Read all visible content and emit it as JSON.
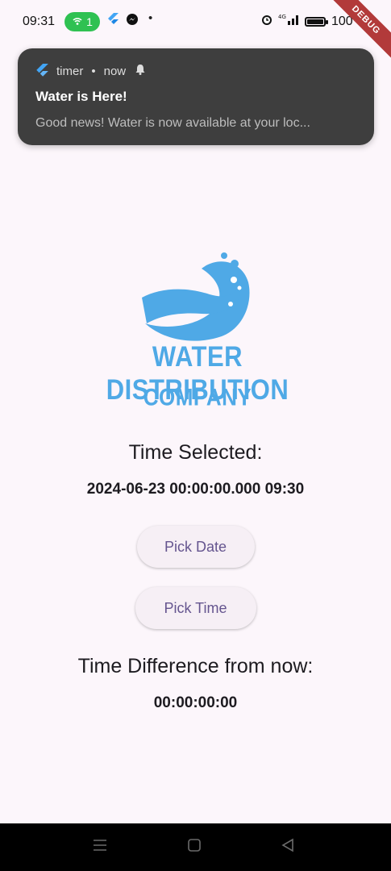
{
  "status_bar": {
    "time": "09:31",
    "hotspot_count": "1",
    "battery_text": "100",
    "battery_level": 1.0,
    "icons": [
      "hotspot-icon",
      "flutter-icon",
      "messenger-icon",
      "dot-icon",
      "alarm-icon",
      "signal-icon",
      "battery-icon"
    ]
  },
  "debug_banner": "DEBUG",
  "notification": {
    "app": "timer",
    "when": "now",
    "title": "Water is Here!",
    "body": "Good news! Water is now available at your loc..."
  },
  "logo": {
    "line1": "WATER DISTRIBUTION",
    "line2": "COMPANY",
    "color": "#4fa9e6"
  },
  "main": {
    "time_selected_label": "Time Selected:",
    "time_selected_value": "2024-06-23 00:00:00.000 09:30",
    "pick_date_label": "Pick Date",
    "pick_time_label": "Pick Time",
    "difference_label": "Time Difference from now:",
    "difference_value": "00:00:00:00"
  },
  "colors": {
    "background": "#fcf6fb",
    "button_text": "#65558f",
    "notification_bg": "#3e3e3e"
  }
}
